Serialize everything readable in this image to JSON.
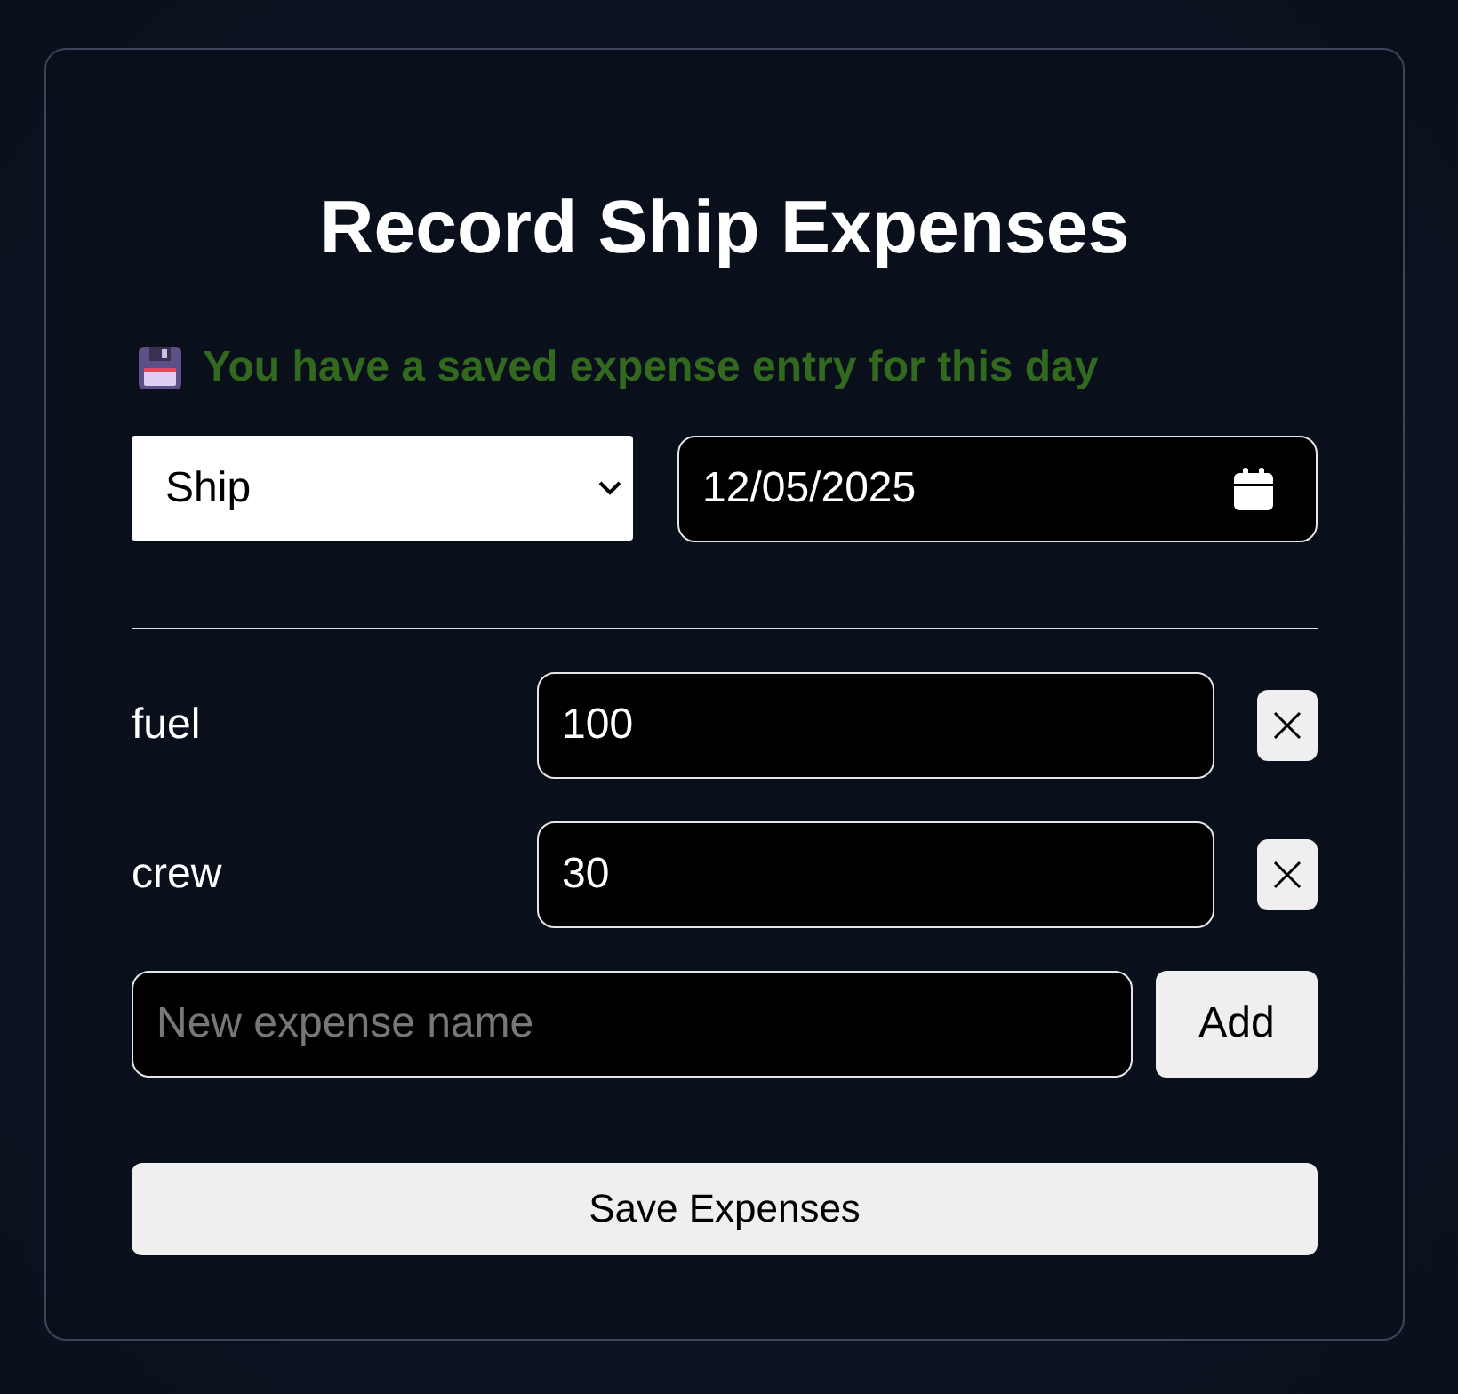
{
  "title": "Record Ship Expenses",
  "notice": {
    "text": "You have a saved expense entry for this day"
  },
  "type_select": {
    "value": "Ship"
  },
  "date_field": {
    "value": "12/05/2025"
  },
  "expenses": [
    {
      "name": "fuel",
      "amount": "100"
    },
    {
      "name": "crew",
      "amount": "30"
    }
  ],
  "new_expense": {
    "placeholder": "New expense name",
    "button": "Add"
  },
  "save_button": "Save Expenses"
}
